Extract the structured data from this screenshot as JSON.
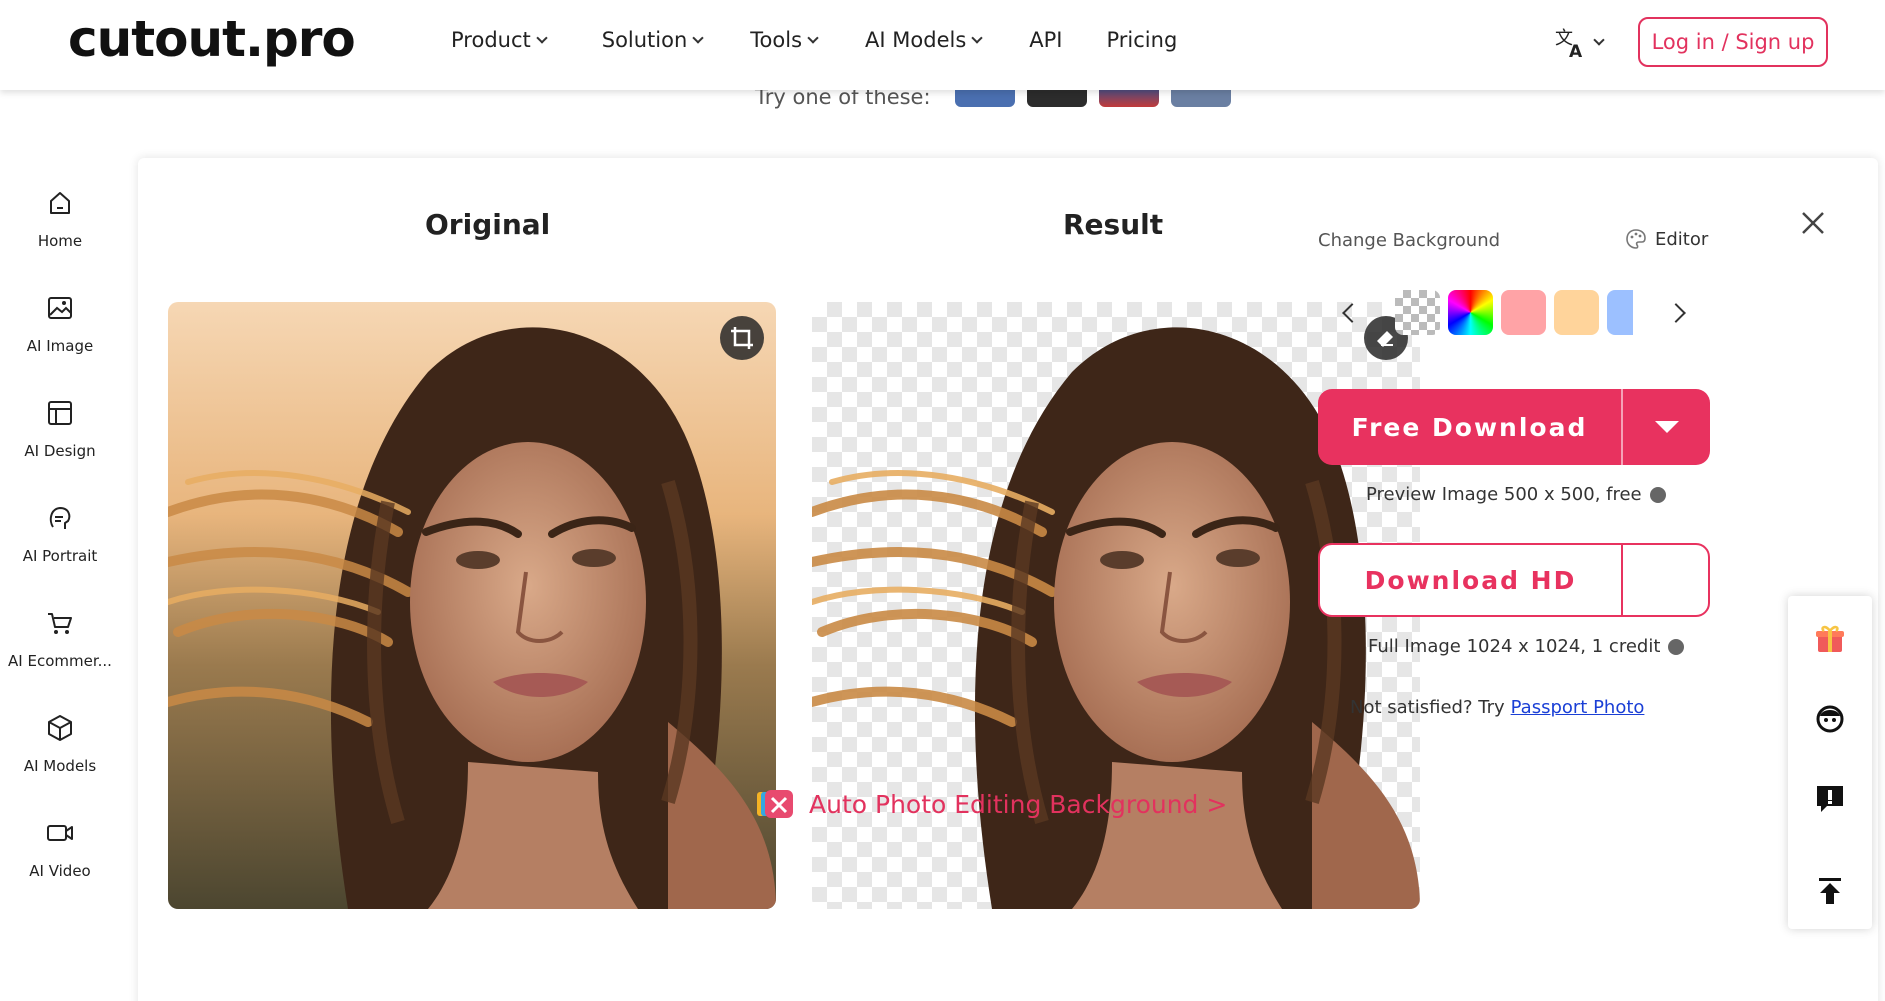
{
  "header": {
    "logo": "cutout.pro",
    "nav": [
      {
        "label": "Product",
        "dropdown": true
      },
      {
        "label": "Solution",
        "dropdown": true
      },
      {
        "label": "Tools",
        "dropdown": true
      },
      {
        "label": "AI Models",
        "dropdown": true
      },
      {
        "label": "API",
        "dropdown": false
      },
      {
        "label": "Pricing",
        "dropdown": false
      }
    ],
    "language_icon": "translate-icon",
    "login_label": "Log in / Sign up"
  },
  "samples": {
    "label": "Try one of these:"
  },
  "sidebar": {
    "items": [
      {
        "label": "Home",
        "icon": "home-icon"
      },
      {
        "label": "AI Image",
        "icon": "image-icon"
      },
      {
        "label": "AI Design",
        "icon": "layout-icon"
      },
      {
        "label": "AI Portrait",
        "icon": "portrait-icon"
      },
      {
        "label": "AI Ecommer...",
        "icon": "cart-icon"
      },
      {
        "label": "AI Models",
        "icon": "cube-icon"
      },
      {
        "label": "AI Video",
        "icon": "video-icon"
      }
    ]
  },
  "main": {
    "original_title": "Original",
    "result_title": "Result",
    "change_background_label": "Change Background",
    "editor_label": "Editor",
    "swatch_colors": [
      "#ffa3a6",
      "#ffd49b",
      "#9cc0ff"
    ],
    "free_download_label": "Free Download",
    "preview_note": "Preview Image 500 x 500, free",
    "download_hd_label": "Download HD",
    "full_note": "Full Image 1024 x 1024, 1 credit",
    "not_satisfied": "Not satisfied? Try",
    "passport_link": "Passport Photo",
    "auto_edit_label": "Auto Photo Editing Background >"
  },
  "colors": {
    "accent": "#e8325f",
    "link": "#1a3fd6"
  }
}
